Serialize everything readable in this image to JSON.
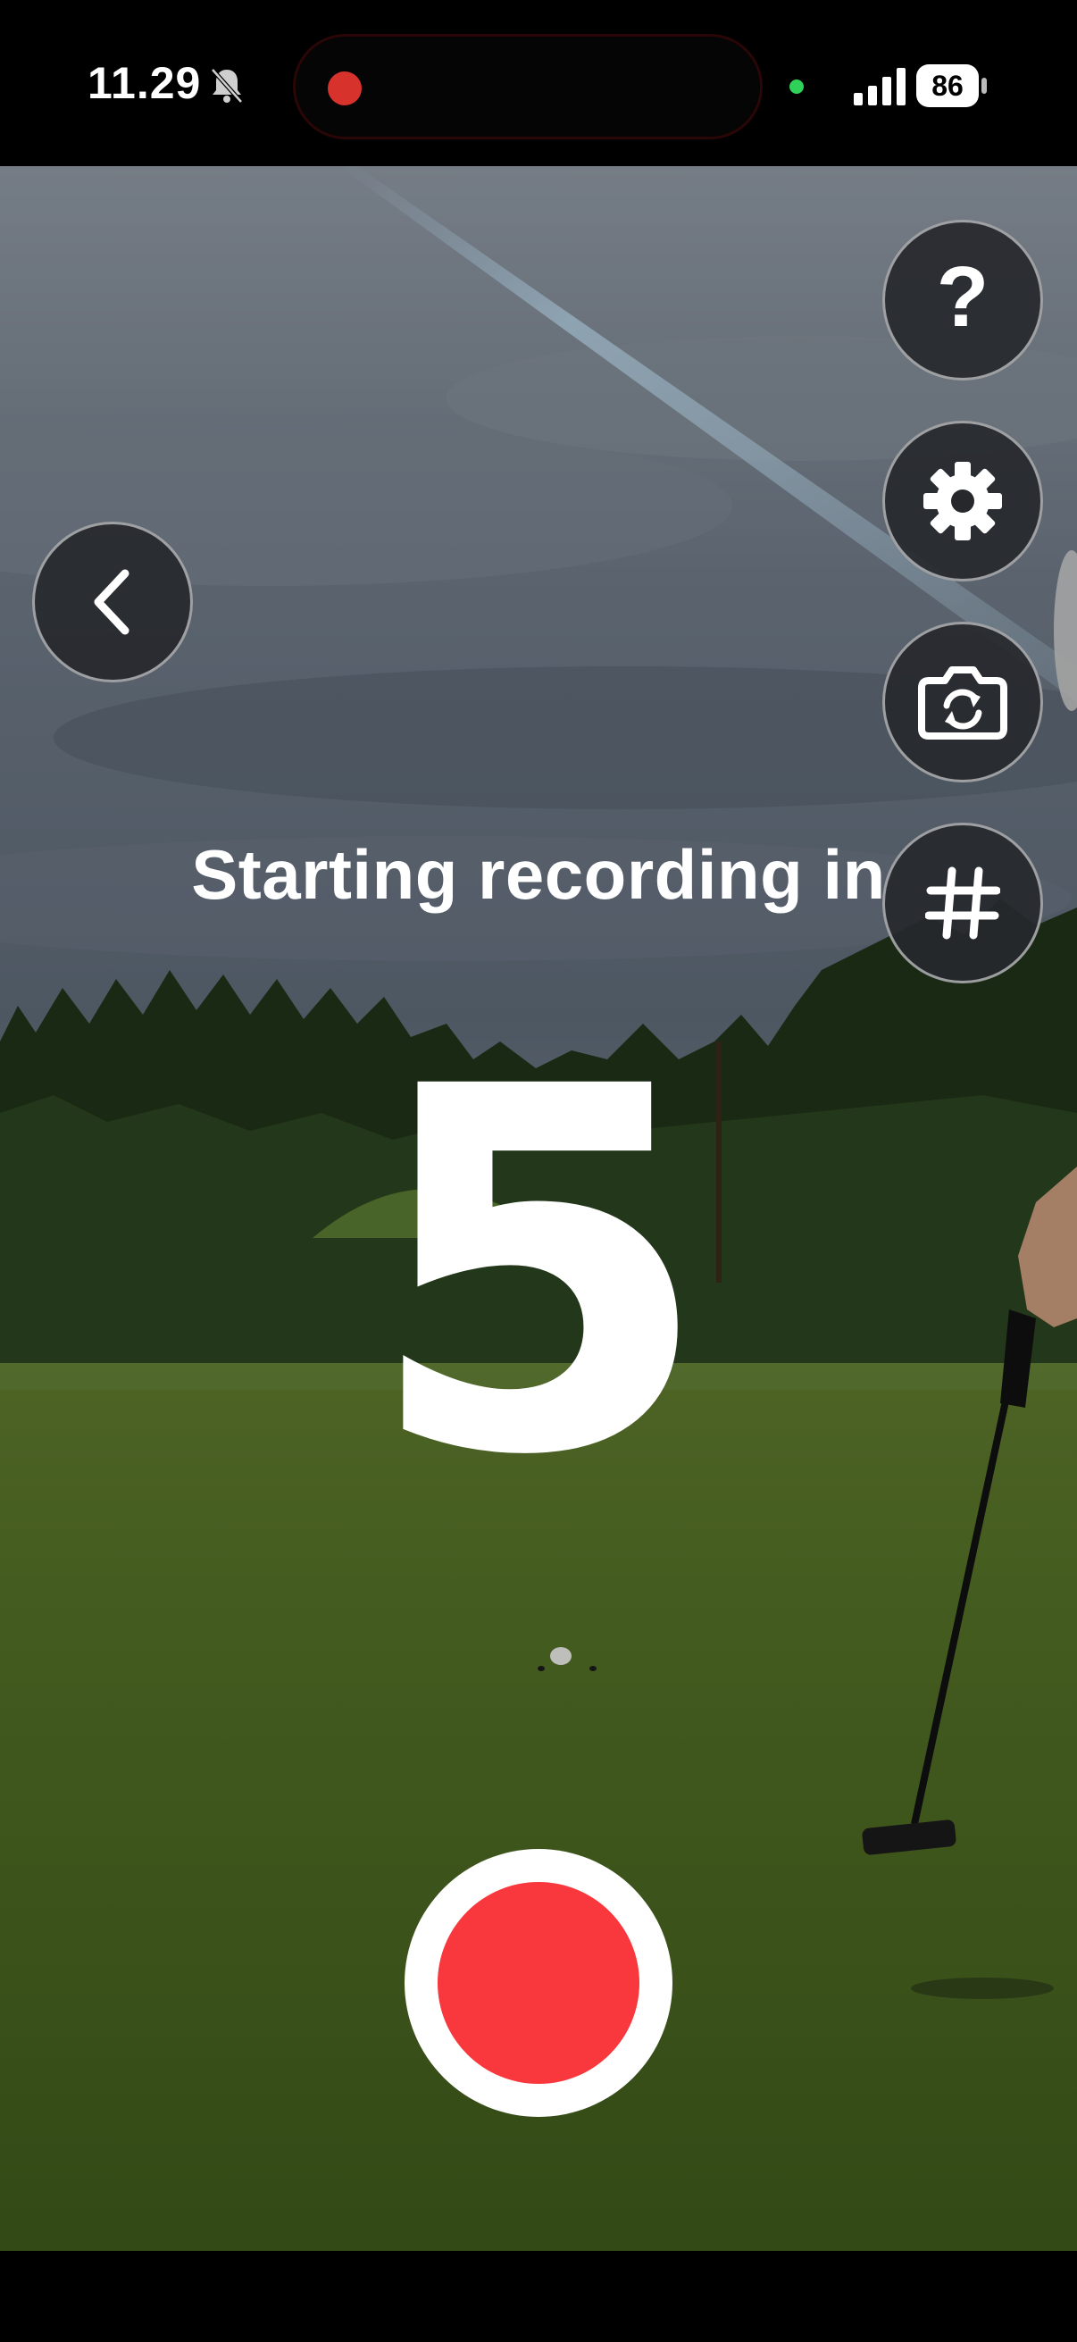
{
  "status_bar": {
    "time": "11.29",
    "battery": "86",
    "icons": [
      "mute-bell-icon",
      "recording-indicator",
      "camera-in-use-dot",
      "signal-icon",
      "battery-icon"
    ]
  },
  "controls": {
    "help_glyph": "?",
    "icons": [
      "help-icon",
      "gear-icon",
      "camera-flip-icon",
      "grid-icon",
      "chevron-left-icon",
      "record-icon"
    ]
  },
  "countdown": {
    "label": "Starting recording in",
    "number": "5"
  },
  "colors": {
    "record": "#f8383c",
    "button_bg": "#26282c",
    "camera_dot": "#2fd158",
    "island_dot": "#d8322d"
  }
}
